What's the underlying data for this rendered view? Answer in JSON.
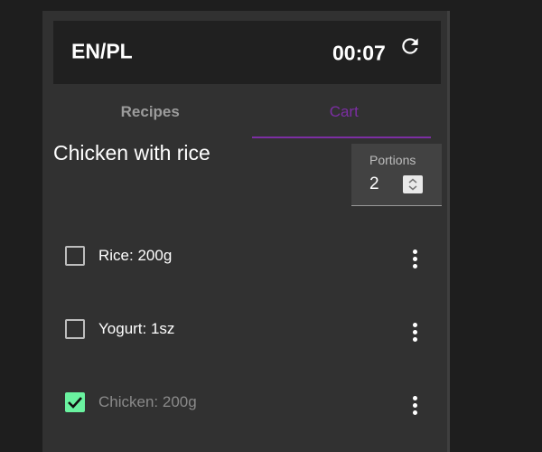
{
  "header": {
    "language": "EN/PL",
    "timer": "00:07",
    "refresh_icon": "refresh-icon"
  },
  "tabs": [
    {
      "label": "Recipes",
      "active": false
    },
    {
      "label": "Cart",
      "active": true
    }
  ],
  "colors": {
    "accent": "#7c2ea3",
    "checked": "#6af2a0",
    "background": "#313131"
  },
  "recipe": {
    "title": "Chicken with rice",
    "portions_label": "Portions",
    "portions_value": "2"
  },
  "items": [
    {
      "label": "Rice: 200g",
      "checked": false
    },
    {
      "label": "Yogurt: 1sz",
      "checked": false
    },
    {
      "label": "Chicken: 200g",
      "checked": true
    }
  ]
}
